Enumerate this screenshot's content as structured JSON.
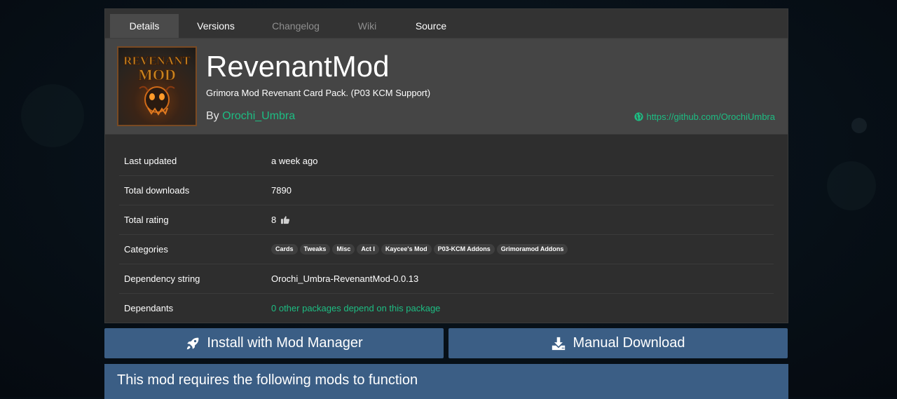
{
  "tabs": [
    {
      "label": "Details",
      "active": true
    },
    {
      "label": "Versions"
    },
    {
      "label": "Changelog",
      "dim": true
    },
    {
      "label": "Wiki",
      "dim": true
    },
    {
      "label": "Source"
    }
  ],
  "package": {
    "name": "RevenantMod",
    "description": "Grimora Mod Revenant Card Pack. (P03 KCM Support)",
    "by_prefix": "By ",
    "author": "Orochi_Umbra",
    "website": "https://github.com/OrochiUmbra",
    "icon": {
      "line1": "REVENANT",
      "line2": "MOD"
    }
  },
  "details": {
    "last_updated": {
      "label": "Last updated",
      "value": "a week ago"
    },
    "total_downloads": {
      "label": "Total downloads",
      "value": "7890"
    },
    "total_rating": {
      "label": "Total rating",
      "value": "8"
    },
    "categories": {
      "label": "Categories",
      "tags": [
        "Cards",
        "Tweaks",
        "Misc",
        "Act I",
        "Kaycee's Mod",
        "P03-KCM Addons",
        "Grimoramod Addons"
      ]
    },
    "dependency_string": {
      "label": "Dependency string",
      "value": "Orochi_Umbra-RevenantMod-0.0.13"
    },
    "dependants": {
      "label": "Dependants",
      "value": "0 other packages depend on this package"
    }
  },
  "actions": {
    "install": "Install with Mod Manager",
    "download": "Manual Download"
  },
  "requires_title": "This mod requires the following mods to function",
  "colors": {
    "accent_green": "#1dbd83",
    "button_blue": "#3b5e85",
    "card_bg": "#2e2e2e",
    "header_bg": "#454545"
  }
}
